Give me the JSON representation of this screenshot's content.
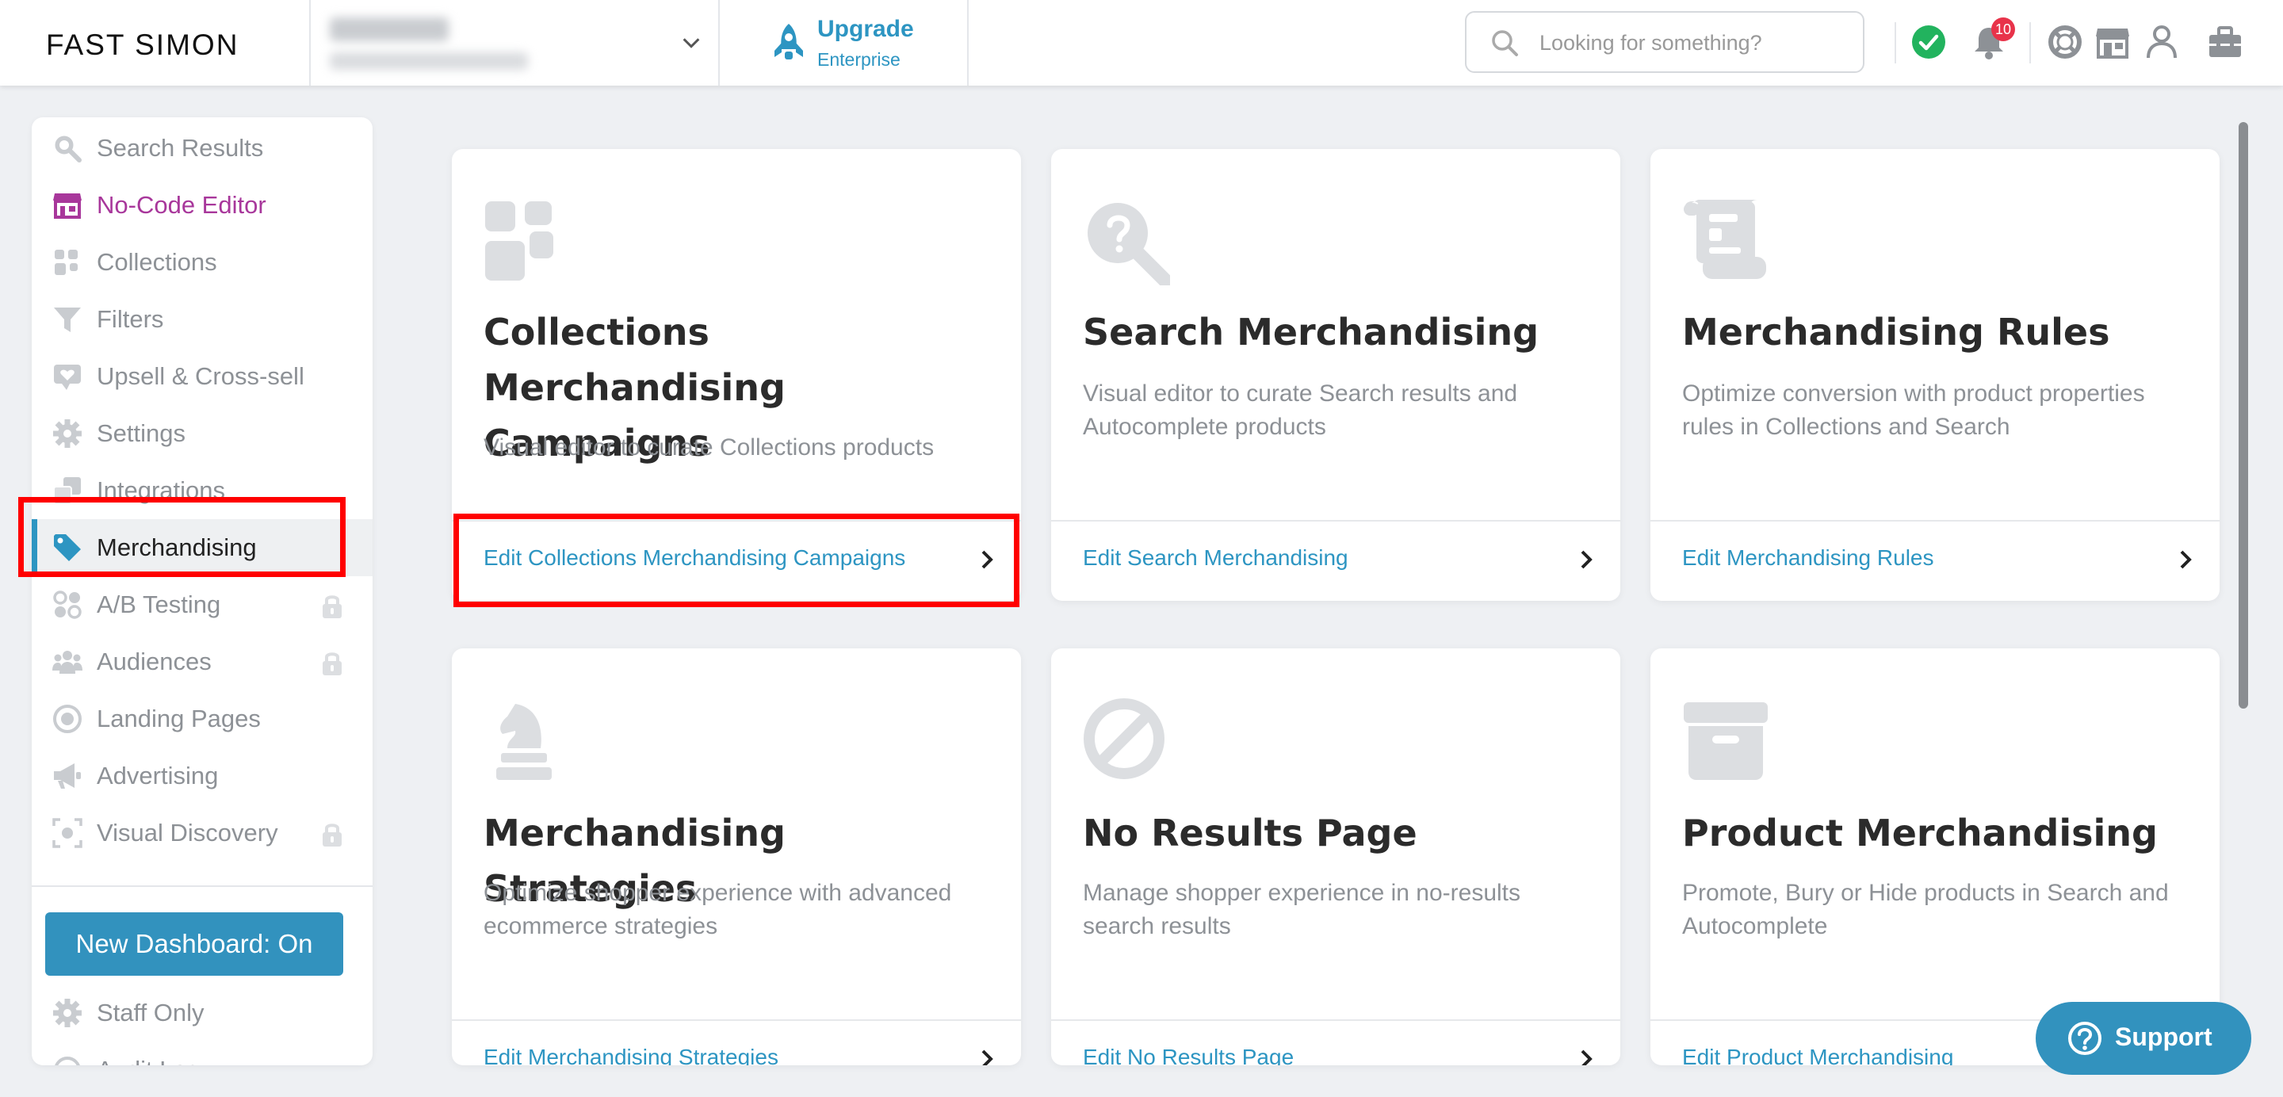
{
  "brand": {
    "logo_text": "FAST SIMON"
  },
  "upgrade": {
    "title": "Upgrade",
    "subtitle": "Enterprise"
  },
  "search": {
    "placeholder": "Looking for something?"
  },
  "header_icons": [
    "status-ok-icon",
    "bell-icon",
    "lifebuoy-icon",
    "store-icon",
    "user-icon",
    "toolbox-icon"
  ],
  "notifications": {
    "count": "10"
  },
  "sidebar": {
    "items": [
      {
        "label": "Search Results",
        "icon": "search-icon"
      },
      {
        "label": "No-Code Editor",
        "icon": "store-icon"
      },
      {
        "label": "Collections",
        "icon": "collections-icon"
      },
      {
        "label": "Filters",
        "icon": "filter-icon"
      },
      {
        "label": "Upsell & Cross-sell",
        "icon": "upsell-icon"
      },
      {
        "label": "Settings",
        "icon": "gear-icon"
      },
      {
        "label": "Integrations",
        "icon": "integrations-icon"
      },
      {
        "label": "Merchandising",
        "icon": "tag-icon",
        "active": true
      },
      {
        "label": "A/B Testing",
        "icon": "ab-testing-icon",
        "locked": true
      },
      {
        "label": "Audiences",
        "icon": "audiences-icon",
        "locked": true
      },
      {
        "label": "Landing Pages",
        "icon": "target-icon"
      },
      {
        "label": "Advertising",
        "icon": "megaphone-icon"
      },
      {
        "label": "Visual Discovery",
        "icon": "visual-discovery-icon",
        "locked": true
      }
    ],
    "dashboard_button": "New Dashboard: On",
    "staff_only": "Staff Only",
    "cut_item": "Audit Log"
  },
  "cards": [
    {
      "title": "Collections Merchandising Campaigns",
      "description": "Visual editor to curate Collections products",
      "link": "Edit Collections Merchandising Campaigns",
      "icon": "collections-icon"
    },
    {
      "title": "Search Merchandising",
      "description": "Visual editor to curate Search results and Autocomplete products",
      "link": "Edit Search Merchandising",
      "icon": "search-question-icon"
    },
    {
      "title": "Merchandising Rules",
      "description": "Optimize conversion with product properties rules in Collections and Search",
      "link": "Edit Merchandising Rules",
      "icon": "scroll-icon"
    },
    {
      "title": "Merchandising Strategies",
      "description": "Optimize shopper experience with advanced ecommerce strategies",
      "link": "Edit Merchandising Strategies",
      "icon": "chess-knight-icon"
    },
    {
      "title": "No Results Page",
      "description": "Manage shopper experience in no-results search results",
      "link": "Edit No Results Page",
      "icon": "ban-icon"
    },
    {
      "title": "Product Merchandising",
      "description": "Promote, Bury or Hide products in Search and Autocomplete",
      "link": "Edit Product Merchandising",
      "icon": "archive-box-icon"
    }
  ],
  "support": {
    "label": "Support"
  },
  "colors": {
    "accent": "#2d95c2",
    "highlight": "#ff0000",
    "badge": "#e8334a",
    "success": "#22b35e",
    "purple": "#a8379b"
  }
}
